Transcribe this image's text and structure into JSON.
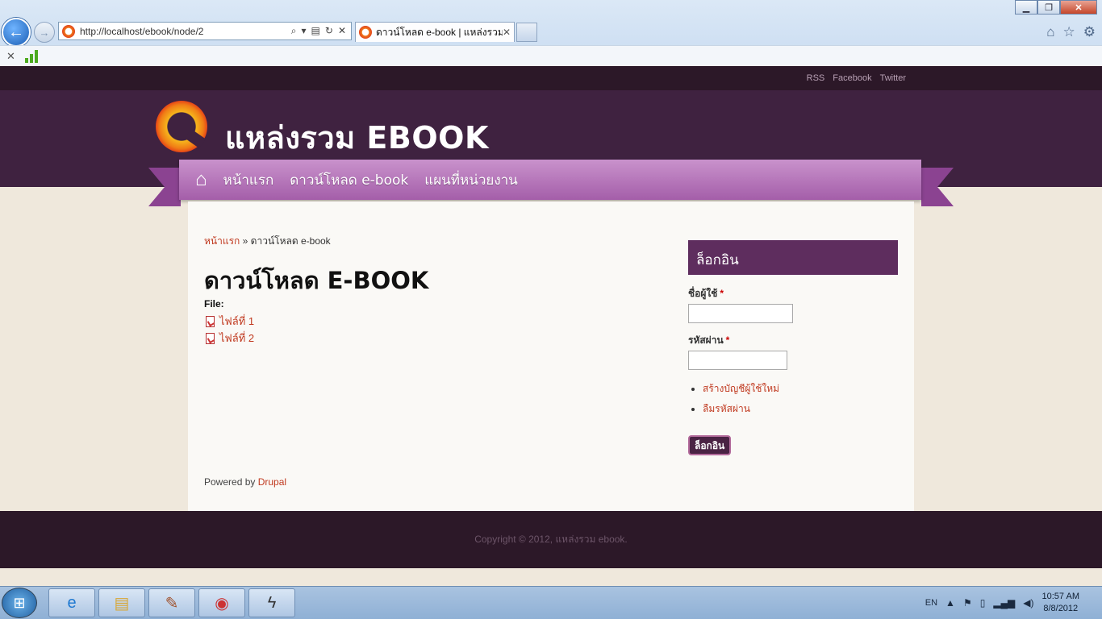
{
  "browser": {
    "url": "http://localhost/ebook/node/2",
    "tab_title": "ดาวน์โหลด e-book | แหล่งรวม...",
    "icons": [
      "back-icon",
      "forward-icon",
      "search-icon",
      "refresh-icon",
      "stop-icon",
      "home-icon",
      "favorites-icon",
      "tools-icon"
    ]
  },
  "site": {
    "top_links": [
      "RSS",
      "Facebook",
      "Twitter"
    ],
    "name": "แหล่งรวม EBOOK",
    "nav": [
      "หน้าแรก",
      "ดาวน์โหลด e-book",
      "แผนที่หน่วยงาน"
    ],
    "breadcrumb": {
      "home": "หน้าแรก",
      "separator": "»",
      "current": "ดาวน์โหลด e-book"
    },
    "page_title": "ดาวน์โหลด E-BOOK",
    "file_label": "File:",
    "files": [
      "ไฟล์ที่ 1",
      "ไฟล์ที่ 2"
    ],
    "powered_by": "Powered by",
    "drupal": "Drupal",
    "copyright": "Copyright © 2012, แหล่งรวม ebook.",
    "accent": "#c0391f",
    "header_color": "#3f2240"
  },
  "login": {
    "title": "ล็อกอิน",
    "username_label": "ชื่อผู้ใช้",
    "password_label": "รหัสผ่าน",
    "required_mark": "*",
    "links": [
      "สร้างบัญชีผู้ใช้ใหม่",
      "ลืมรหัสผ่าน"
    ],
    "button": "ล็อกอิน"
  },
  "taskbar": {
    "lang": "EN",
    "time": "10:57 AM",
    "date": "8/8/2012"
  }
}
